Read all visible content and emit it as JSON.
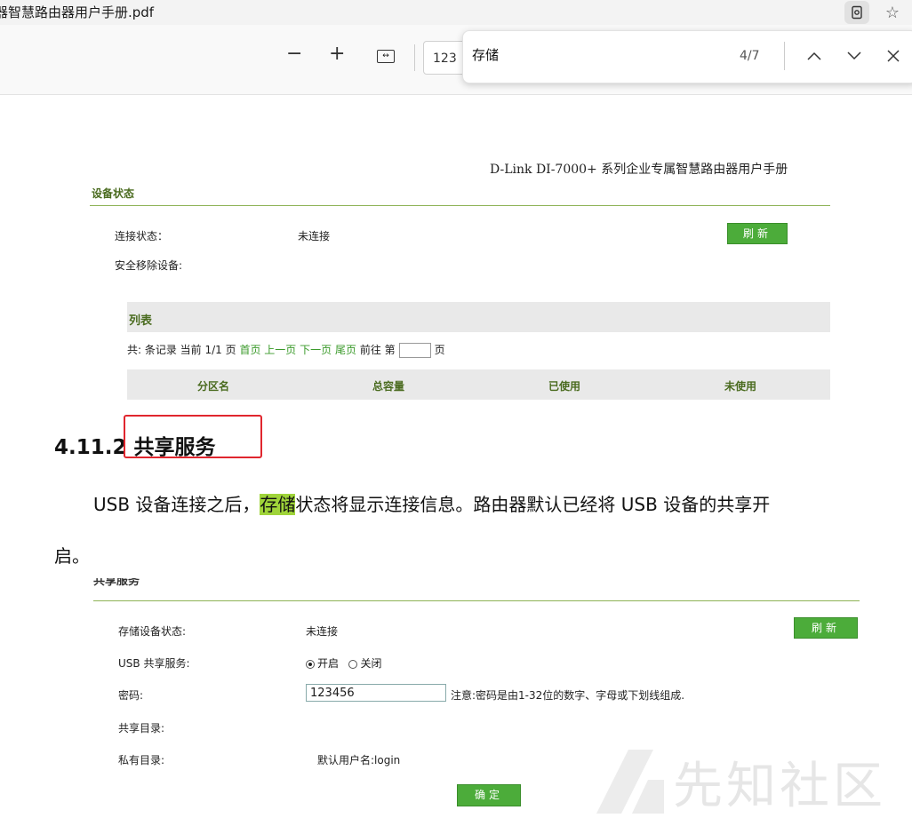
{
  "window": {
    "title": "器智慧路由器用户手册.pdf"
  },
  "toolbar": {
    "zoom_out": "−",
    "zoom_in": "+",
    "page_value": "123",
    "find": {
      "query": "存储",
      "count": "4/7"
    }
  },
  "page": {
    "header": "D-Link  DI-7000+  系列企业专属智慧路由器用户手册",
    "figure1": {
      "heading": "设备状态",
      "conn_label": "连接状态：",
      "conn_value": "未连接",
      "refresh": "刷新",
      "safe_remove": "安全移除设备:",
      "list_title": "列表",
      "pager": {
        "prefix": "共: 条记录 当前 1/1 页",
        "first": "首页",
        "prev": "上一页",
        "next": "下一页",
        "last": "尾页",
        "goto": "前往 第",
        "page_unit": "页"
      },
      "columns": [
        "分区名",
        "总容量",
        "已使用",
        "未使用"
      ]
    },
    "section": {
      "number": "4.11.2",
      "title": "共享服务"
    },
    "body": {
      "line1_pre": "USB 设备连接之后，",
      "line1_hl": "存储",
      "line1_post": "状态将显示连接信息。路由器默认已经将 USB 设备的共享开",
      "line2": "启。"
    },
    "figure2": {
      "heading_cut": "共享服务",
      "storage_label": "存储设备状态:",
      "storage_value": "未连接",
      "refresh": "刷新",
      "usb_label": "USB 共享服务:",
      "radio_on": "开启",
      "radio_off": "关闭",
      "pwd_label": "密码:",
      "pwd_value": "123456",
      "pwd_note": "注意:密码是由1-32位的数字、字母或下划线组成.",
      "share_dir": "共享目录:",
      "private_dir": "私有目录:",
      "default_user": "默认用户名:login",
      "confirm": "确定"
    },
    "watermark": "先知社区"
  }
}
